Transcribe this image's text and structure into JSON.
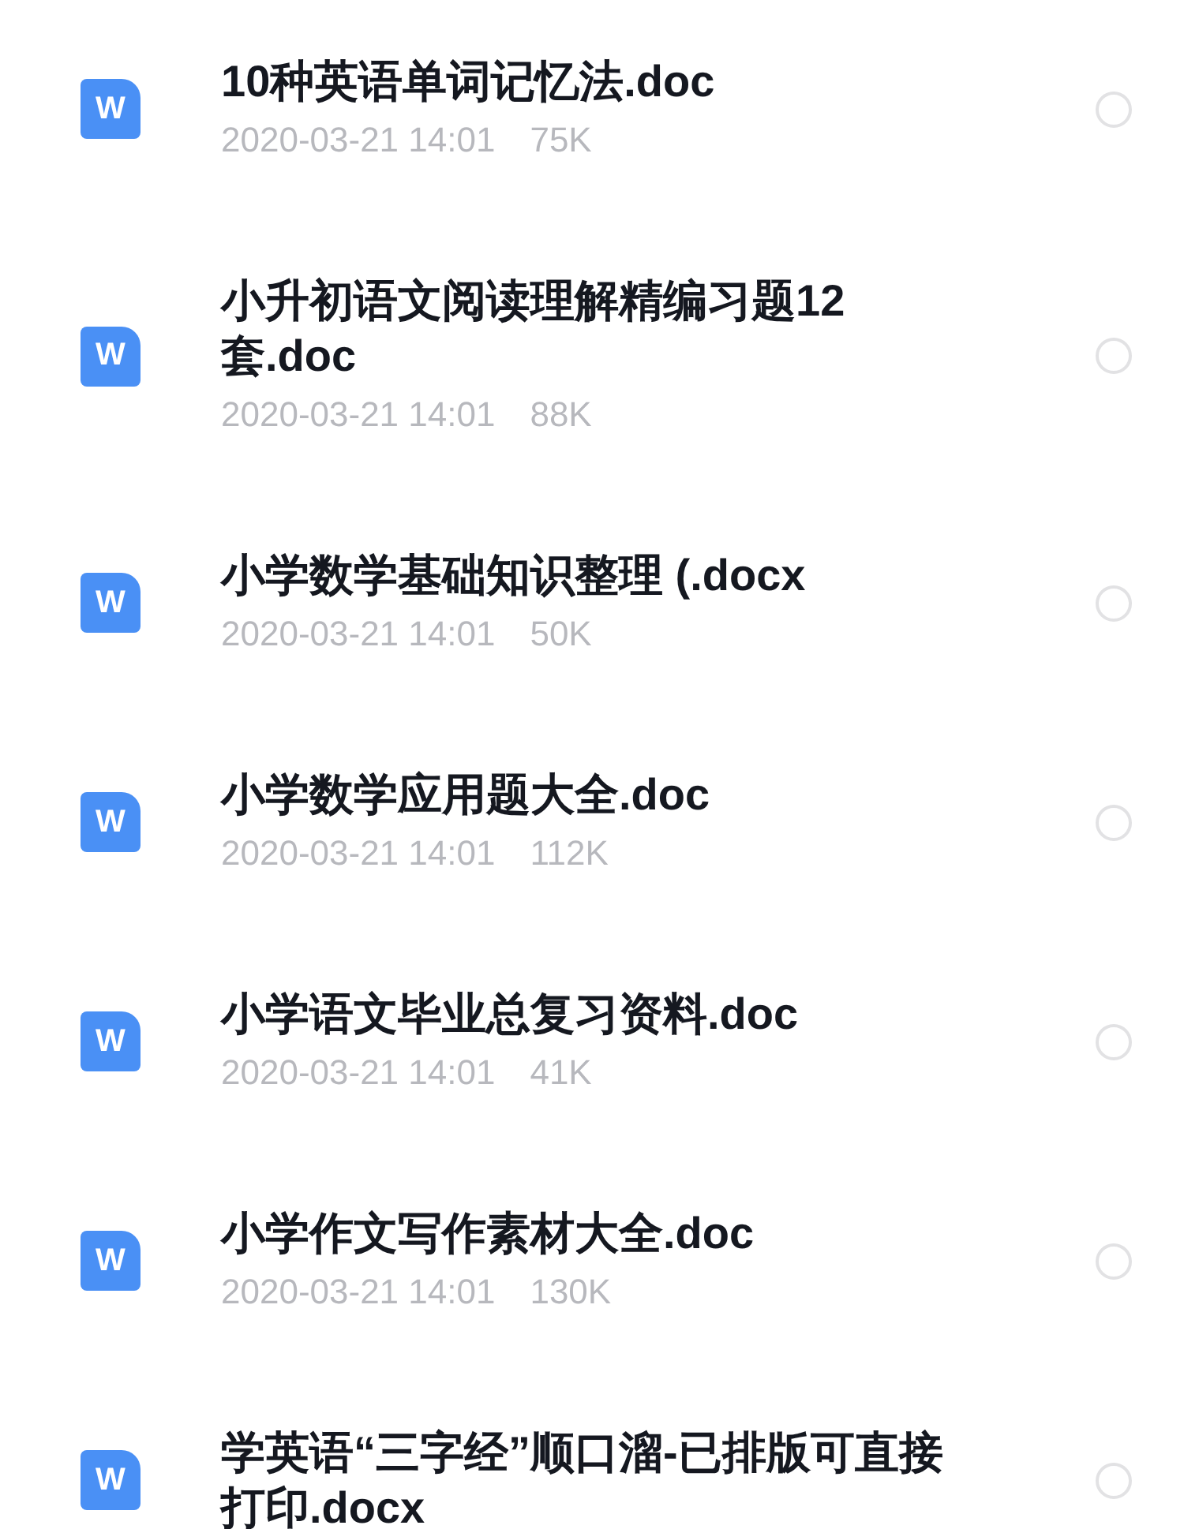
{
  "files": [
    {
      "icon": "W",
      "name": "10种英语单词记忆法.doc",
      "time": "2020-03-21 14:01",
      "size": "75K",
      "selected": false
    },
    {
      "icon": "W",
      "name": "小升初语文阅读理解精编习题12套.doc",
      "time": "2020-03-21 14:01",
      "size": "88K",
      "selected": false
    },
    {
      "icon": "W",
      "name": "小学数学基础知识整理 (.docx",
      "time": "2020-03-21 14:01",
      "size": "50K",
      "selected": false
    },
    {
      "icon": "W",
      "name": "小学数学应用题大全.doc",
      "time": "2020-03-21 14:01",
      "size": "112K",
      "selected": false
    },
    {
      "icon": "W",
      "name": "小学语文毕业总复习资料.doc",
      "time": "2020-03-21 14:01",
      "size": "41K",
      "selected": false
    },
    {
      "icon": "W",
      "name": "小学作文写作素材大全.doc",
      "time": "2020-03-21 14:01",
      "size": "130K",
      "selected": false
    },
    {
      "icon": "W",
      "name": "学英语“三字经”顺口溜-已排版可直接打印.docx",
      "selected": false
    }
  ]
}
